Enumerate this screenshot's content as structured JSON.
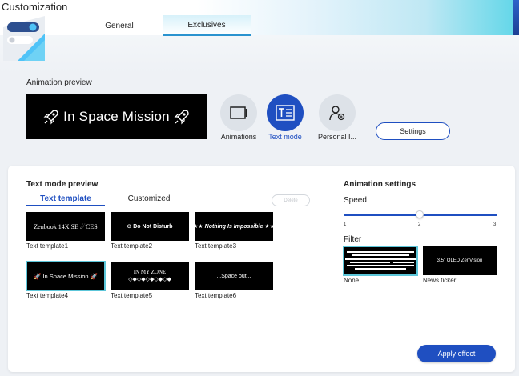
{
  "app": {
    "title": "Customization"
  },
  "tabs": [
    {
      "label": "General",
      "active": false
    },
    {
      "label": "Exclusives",
      "active": true
    }
  ],
  "preview": {
    "section_label": "Animation preview",
    "text": "In Space Mission",
    "icon": "rocket-icon"
  },
  "modes": [
    {
      "label": "Animations",
      "icon": "screen-icon",
      "active": false
    },
    {
      "label": "Text mode",
      "icon": "text-mode-icon",
      "active": true
    },
    {
      "label": "Personal I...",
      "icon": "personal-icon",
      "active": false
    }
  ],
  "settings_button": "Settings",
  "text_mode": {
    "title": "Text mode preview",
    "subtabs": [
      {
        "label": "Text template",
        "active": true
      },
      {
        "label": "Customized",
        "active": false
      }
    ],
    "delete_label": "Delete",
    "templates": [
      {
        "label": "Text template1",
        "display": "Zenbook 14X SE ☄CES",
        "selected": false
      },
      {
        "label": "Text template2",
        "display": "⊖ Do Not Disturb",
        "selected": false
      },
      {
        "label": "Text template3",
        "display": "★★ Nothing Is Impossible ★★",
        "selected": false
      },
      {
        "label": "Text template4",
        "display": "In Space Mission",
        "selected": true
      },
      {
        "label": "Text template5",
        "display": "IN MY ZONE",
        "display2": "◇◆◇◆◇◆◇◆◇◆",
        "selected": false
      },
      {
        "label": "Text template6",
        "display": "...Space out...",
        "selected": false
      }
    ]
  },
  "animation_settings": {
    "title": "Animation settings",
    "speed_label": "Speed",
    "speed": {
      "min": "1",
      "mid": "2",
      "max": "3",
      "value": 2
    },
    "filter_label": "Filter",
    "filters": [
      {
        "label": "None",
        "display": "",
        "selected": true
      },
      {
        "label": "News ticker",
        "display": "3.5\" OLED ZenVision",
        "selected": false
      }
    ]
  },
  "apply_button": "Apply effect",
  "colors": {
    "accent": "#1f4fc1",
    "selection": "#5cc6d9",
    "tile_bg": "#000000"
  }
}
